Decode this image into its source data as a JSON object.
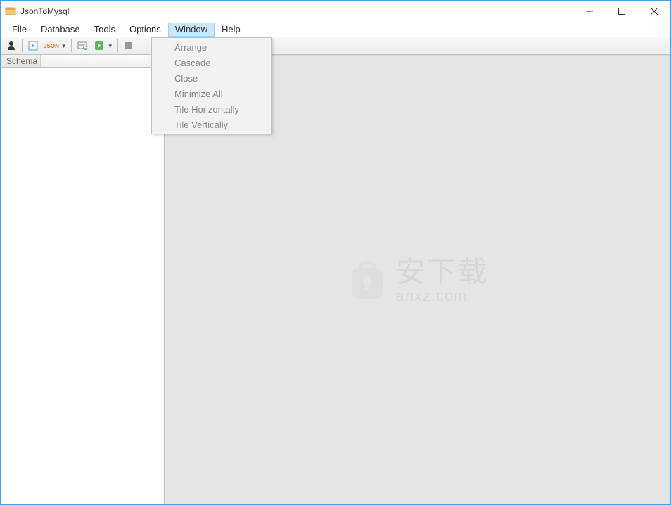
{
  "window": {
    "title": "JsonToMysql"
  },
  "menubar": {
    "items": [
      {
        "label": "File"
      },
      {
        "label": "Database"
      },
      {
        "label": "Tools"
      },
      {
        "label": "Options"
      },
      {
        "label": "Window",
        "active": true
      },
      {
        "label": "Help"
      }
    ]
  },
  "dropdown": {
    "items": [
      {
        "label": "Arrange"
      },
      {
        "label": "Cascade"
      },
      {
        "label": "Close"
      },
      {
        "label": "Minimize All"
      },
      {
        "label": "Tile Horizontally"
      },
      {
        "label": "Tile Vertically"
      }
    ]
  },
  "sidebar": {
    "schema_label": "Schema"
  },
  "toolbar": {
    "json_label": "JSON"
  },
  "watermark": {
    "cn": "安下载",
    "en": "anxz.com"
  }
}
